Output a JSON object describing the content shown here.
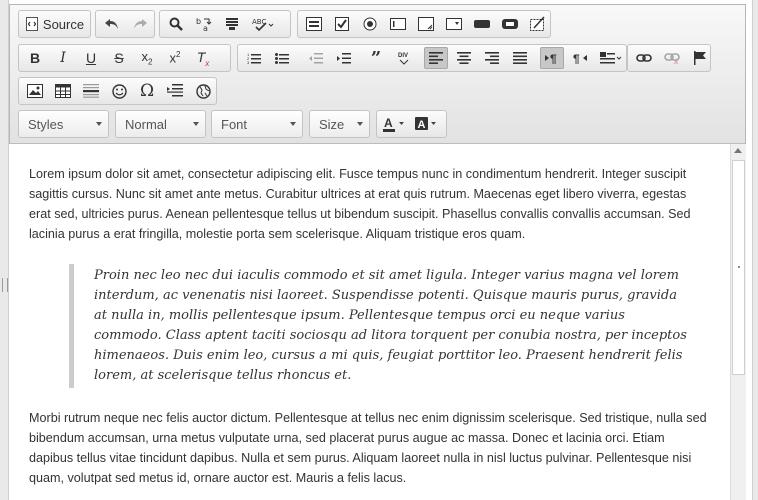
{
  "toolbar": {
    "source_label": "Source",
    "styles_label": "Styles",
    "format_label": "Normal",
    "font_label": "Font",
    "size_label": "Size"
  },
  "icons": [
    "source-icon",
    "undo-icon",
    "redo-icon",
    "find-icon",
    "replace-icon",
    "select-all-icon",
    "spellcheck-icon",
    "form-icon",
    "checkbox-icon",
    "radio-icon",
    "text-field-icon",
    "textarea-icon",
    "select-icon",
    "button-icon",
    "image-button-icon",
    "hidden-field-icon",
    "bold-icon",
    "italic-icon",
    "underline-icon",
    "strike-icon",
    "subscript-icon",
    "superscript-icon",
    "remove-format-icon",
    "numbered-list-icon",
    "bulleted-list-icon",
    "outdent-icon",
    "indent-icon",
    "blockquote-icon",
    "div-icon",
    "align-left-icon",
    "align-center-icon",
    "align-right-icon",
    "justify-icon",
    "ltr-icon",
    "rtl-icon",
    "language-icon",
    "link-icon",
    "unlink-icon",
    "anchor-icon",
    "image-icon",
    "table-icon",
    "horizontal-rule-icon",
    "smiley-icon",
    "special-char-icon",
    "page-break-icon",
    "iframe-icon",
    "text-color-icon",
    "bg-color-icon"
  ],
  "content": {
    "p1": "Lorem ipsum dolor sit amet, consectetur adipiscing elit. Fusce tempus nunc in condimentum hendrerit. Integer suscipit sagittis cursus. Nunc sit amet ante metus. Curabitur ultrices at erat quis rutrum. Maecenas eget libero viverra, egestas erat sed, ultricies purus. Aenean pellentesque tellus ut bibendum suscipit. Phasellus convallis convallis accumsan. Sed lacinia purus a erat fringilla, molestie porta sem scelerisque. Aliquam tristique eros quam.",
    "quote": "Proin nec leo nec dui iaculis commodo et sit amet ligula. Integer varius magna vel lorem interdum, ac venenatis nisi laoreet. Suspendisse potenti. Quisque mauris purus, gravida at nulla in, mollis pellentesque ipsum. Pellentesque tempus orci eu neque varius commodo. Class aptent taciti sociosqu ad litora torquent per conubia nostra, per inceptos himenaeos. Duis enim leo, cursus a mi quis, feugiat porttitor leo. Praesent hendrerit felis lorem, at scelerisque tellus rhoncus et.",
    "p2": "Morbi rutrum neque nec felis auctor dictum. Pellentesque at tellus nec enim dignissim scelerisque. Sed tristique, nulla sed bibendum accumsan, urna metus vulputate urna, sed placerat purus augue ac massa. Donec et lacinia orci. Etiam dapibus tellus vitae tincidunt dapibus. Nulla et sem purus. Aliquam laoreet nulla in nisl luctus pulvinar. Pellentesque nisi quam, volutpat sed metus id, ornare auctor est. Mauris a felis lacus."
  },
  "colors": {
    "accent": "#c7c7c7",
    "text": "#333333",
    "toolbar_bg": "#e2e2e2"
  }
}
